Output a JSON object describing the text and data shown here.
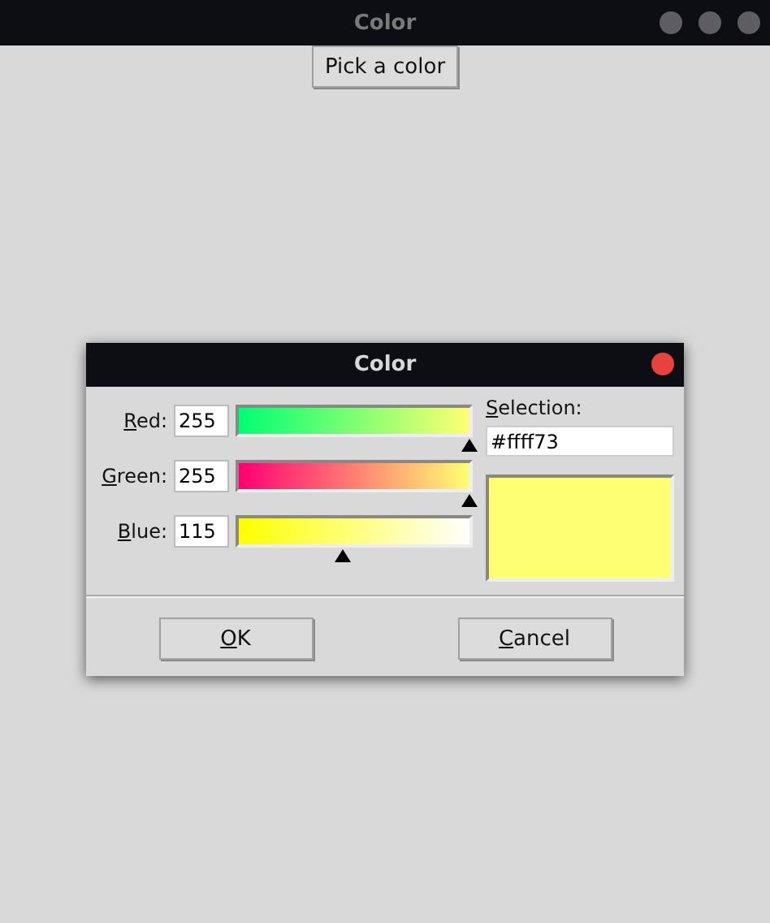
{
  "window": {
    "title": "Color"
  },
  "pick_button": "Pick a color",
  "dialog": {
    "title": "Color",
    "channels": [
      {
        "label": "Red:",
        "underline_first": true,
        "value": "255",
        "level": 1.0
      },
      {
        "label": "Green:",
        "underline_first": true,
        "value": "255",
        "level": 1.0
      },
      {
        "label": "Blue:",
        "underline_first": true,
        "value": "115",
        "level": 0.45
      }
    ],
    "selection_label": "Selection:",
    "selection_underline_first": true,
    "selection_value": "#ffff73",
    "buttons": [
      {
        "label": "OK",
        "underline_first": true
      },
      {
        "label": "Cancel",
        "underline_first": true
      }
    ]
  }
}
